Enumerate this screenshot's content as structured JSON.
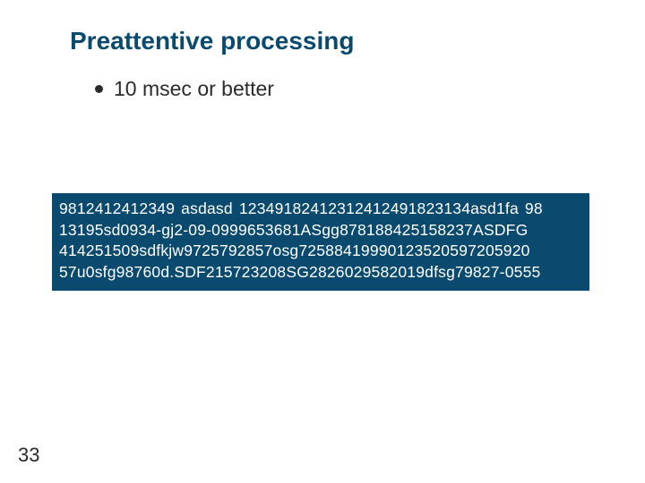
{
  "slide": {
    "title": "Preattentive processing",
    "bullet": "10 msec or better",
    "block_lines": [
      "9812412412349 asdasd 12349182412312412491823134asd1fa 98",
      "13195sd0934-gj2-09-0999653681ASgg878188425158237ASDFG",
      "414251509sdfkjw9725792857osg72588419990123520597205920",
      "57u0sfg98760d.SDF215723208SG2826029582019dfsg79827-0555"
    ],
    "page_number": "33"
  }
}
